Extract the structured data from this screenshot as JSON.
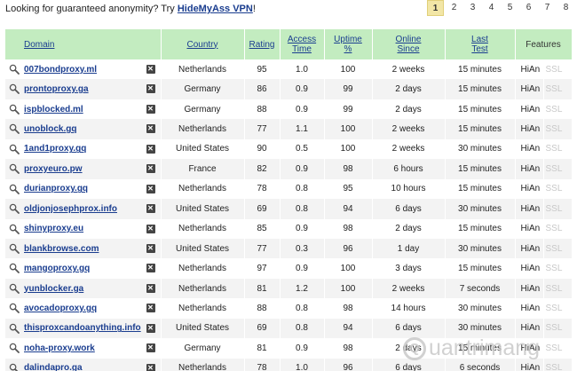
{
  "promo": {
    "prefix": "Looking for guaranteed anonymity? Try ",
    "link": "HideMyAss VPN",
    "suffix": "!"
  },
  "pager": {
    "pages": [
      "1",
      "2",
      "3",
      "4",
      "5",
      "6",
      "7",
      "8"
    ],
    "active": "1"
  },
  "table": {
    "headers": {
      "domain": "Domain",
      "country": "Country",
      "rating": "Rating",
      "access_time": [
        "Access",
        "Time"
      ],
      "uptime": [
        "Uptime",
        "%"
      ],
      "online_since": [
        "Online",
        "Since"
      ],
      "last_test": [
        "Last",
        "Test"
      ],
      "features": "Features"
    },
    "rows": [
      {
        "domain": "007bondproxy.ml",
        "country": "Netherlands",
        "rating": "95",
        "access": "1.0",
        "uptime": "100",
        "online": "2 weeks",
        "last": "15 minutes",
        "feat": "HiAn",
        "ssl": "SSL"
      },
      {
        "domain": "prontoproxy.ga",
        "country": "Germany",
        "rating": "86",
        "access": "0.9",
        "uptime": "99",
        "online": "2 days",
        "last": "15 minutes",
        "feat": "HiAn",
        "ssl": "SSL"
      },
      {
        "domain": "ispblocked.ml",
        "country": "Germany",
        "rating": "88",
        "access": "0.9",
        "uptime": "99",
        "online": "2 days",
        "last": "15 minutes",
        "feat": "HiAn",
        "ssl": "SSL"
      },
      {
        "domain": "unoblock.gq",
        "country": "Netherlands",
        "rating": "77",
        "access": "1.1",
        "uptime": "100",
        "online": "2 weeks",
        "last": "15 minutes",
        "feat": "HiAn",
        "ssl": "SSL"
      },
      {
        "domain": "1and1proxy.gq",
        "country": "United States",
        "rating": "90",
        "access": "0.5",
        "uptime": "100",
        "online": "2 weeks",
        "last": "30 minutes",
        "feat": "HiAn",
        "ssl": "SSL"
      },
      {
        "domain": "proxyeuro.pw",
        "country": "France",
        "rating": "82",
        "access": "0.9",
        "uptime": "98",
        "online": "6 hours",
        "last": "15 minutes",
        "feat": "HiAn",
        "ssl": "SSL"
      },
      {
        "domain": "durianproxy.gq",
        "country": "Netherlands",
        "rating": "78",
        "access": "0.8",
        "uptime": "95",
        "online": "10 hours",
        "last": "15 minutes",
        "feat": "HiAn",
        "ssl": "SSL"
      },
      {
        "domain": "oldjonjosephprox.info",
        "country": "United States",
        "rating": "69",
        "access": "0.8",
        "uptime": "94",
        "online": "6 days",
        "last": "30 minutes",
        "feat": "HiAn",
        "ssl": "SSL"
      },
      {
        "domain": "shinyproxy.eu",
        "country": "Netherlands",
        "rating": "85",
        "access": "0.9",
        "uptime": "98",
        "online": "2 days",
        "last": "15 minutes",
        "feat": "HiAn",
        "ssl": "SSL"
      },
      {
        "domain": "blankbrowse.com",
        "country": "United States",
        "rating": "77",
        "access": "0.3",
        "uptime": "96",
        "online": "1 day",
        "last": "30 minutes",
        "feat": "HiAn",
        "ssl": "SSL"
      },
      {
        "domain": "mangoproxy.gq",
        "country": "Netherlands",
        "rating": "97",
        "access": "0.9",
        "uptime": "100",
        "online": "3 days",
        "last": "15 minutes",
        "feat": "HiAn",
        "ssl": "SSL"
      },
      {
        "domain": "yunblocker.ga",
        "country": "Netherlands",
        "rating": "81",
        "access": "1.2",
        "uptime": "100",
        "online": "2 weeks",
        "last": "7 seconds",
        "feat": "HiAn",
        "ssl": "SSL"
      },
      {
        "domain": "avocadoproxy.gq",
        "country": "Netherlands",
        "rating": "88",
        "access": "0.8",
        "uptime": "98",
        "online": "14 hours",
        "last": "30 minutes",
        "feat": "HiAn",
        "ssl": "SSL"
      },
      {
        "domain": "thisproxcandoanything.info",
        "country": "United States",
        "rating": "69",
        "access": "0.8",
        "uptime": "94",
        "online": "6 days",
        "last": "30 minutes",
        "feat": "HiAn",
        "ssl": "SSL"
      },
      {
        "domain": "noha-proxy.work",
        "country": "Germany",
        "rating": "81",
        "access": "0.9",
        "uptime": "98",
        "online": "2 days",
        "last": "15 minutes",
        "feat": "HiAn",
        "ssl": "SSL"
      },
      {
        "domain": "dalindapro.ga",
        "country": "Netherlands",
        "rating": "78",
        "access": "1.0",
        "uptime": "96",
        "online": "6 days",
        "last": "6 seconds",
        "feat": "HiAn",
        "ssl": "SSL"
      }
    ]
  },
  "watermark": {
    "text": "uantrimang"
  },
  "colors": {
    "header_bg": "#c3ecc0",
    "link": "#1a3d8f",
    "row_alt": "#f3f3f3",
    "active_page": "#f2e6a6"
  }
}
